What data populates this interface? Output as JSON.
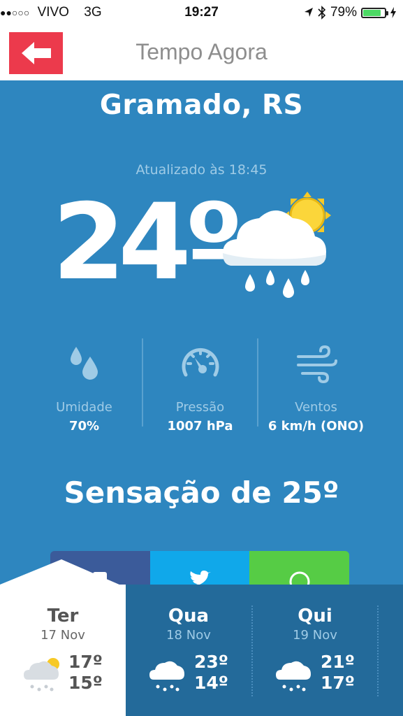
{
  "status_bar": {
    "signal": "●●○○○",
    "carrier": "VIVO",
    "network": "3G",
    "time": "19:27",
    "battery": "79%"
  },
  "header": {
    "title": "Tempo Agora",
    "back_icon": "arrow-left-icon"
  },
  "weather": {
    "city": "Gramado, RS",
    "updated": "Atualizado às 18:45",
    "temperature": "24º",
    "condition_icon": "partly-sunny-rain-icon"
  },
  "stats": [
    {
      "label": "Umidade",
      "value": "70%",
      "icon": "humidity-drops-icon"
    },
    {
      "label": "Pressão",
      "value": "1007 hPa",
      "icon": "pressure-gauge-icon"
    },
    {
      "label": "Ventos",
      "value": "6 km/h (ONO)",
      "icon": "wind-icon"
    }
  ],
  "sensation": "Sensação de 25º",
  "share": [
    {
      "network": "facebook",
      "icon": "facebook-icon"
    },
    {
      "network": "twitter",
      "icon": "twitter-icon"
    },
    {
      "network": "whatsapp",
      "icon": "whatsapp-icon"
    }
  ],
  "forecast": [
    {
      "day": "Ter",
      "date": "17 Nov",
      "max": "17º",
      "min": "15º",
      "selected": true
    },
    {
      "day": "Qua",
      "date": "18 Nov",
      "max": "23º",
      "min": "14º",
      "selected": false
    },
    {
      "day": "Qui",
      "date": "19 Nov",
      "max": "21º",
      "min": "17º",
      "selected": false
    }
  ],
  "colors": {
    "background": "#2e86bf",
    "forecast_bar": "#236a9a",
    "back_button": "#ec3a4c",
    "facebook": "#3b5b9a",
    "twitter": "#10a8ea",
    "whatsapp": "#56cc45"
  }
}
